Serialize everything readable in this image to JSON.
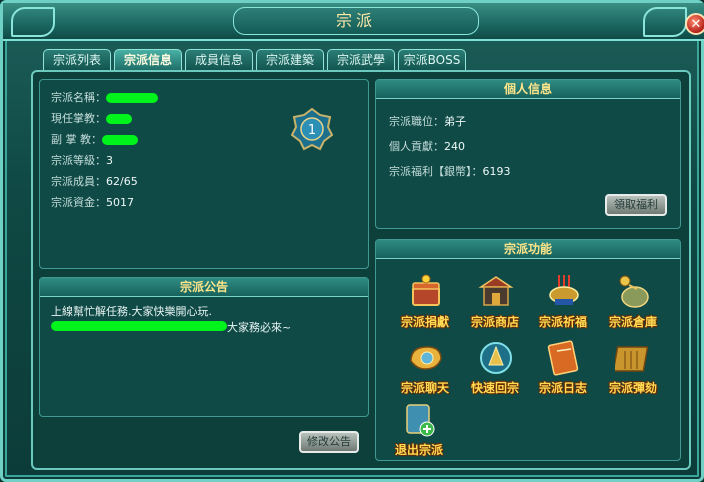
{
  "window": {
    "title": "宗派",
    "close_label": "✕"
  },
  "tabs": [
    {
      "label": "宗派列表",
      "active": false
    },
    {
      "label": "宗派信息",
      "active": true
    },
    {
      "label": "成員信息",
      "active": false
    },
    {
      "label": "宗派建築",
      "active": false
    },
    {
      "label": "宗派武學",
      "active": false
    },
    {
      "label": "宗派BOSS",
      "active": false
    }
  ],
  "sect_info": {
    "name_label": "宗派名稱：",
    "leader_label": "現任掌教：",
    "vice_label": "副 掌 教：",
    "level_label": "宗派等級：",
    "level_value": "3",
    "members_label": "宗派成員：",
    "members_value": "62/65",
    "funds_label": "宗派資金：",
    "funds_value": "5017",
    "emblem_level": "1"
  },
  "notice": {
    "title": "宗派公告",
    "line1": "上線幫忙解任務.大家快樂開心玩.",
    "line2_suffix": "大家務必來~",
    "edit_button": "修改公告"
  },
  "personal": {
    "title": "個人信息",
    "position_label": "宗派職位：",
    "position_value": "弟子",
    "contribution_label": "個人貢獻：",
    "contribution_value": "240",
    "welfare_label": "宗派福利【銀幣】：",
    "welfare_value": "6193",
    "claim_button": "領取福利"
  },
  "functions": {
    "title": "宗派功能",
    "items": [
      {
        "label": "宗派捐獻",
        "icon": "donation-chest-icon"
      },
      {
        "label": "宗派商店",
        "icon": "shop-building-icon"
      },
      {
        "label": "宗派祈福",
        "icon": "incense-burner-icon"
      },
      {
        "label": "宗派倉庫",
        "icon": "warehouse-sack-icon"
      },
      {
        "label": "宗派聊天",
        "icon": "chat-horn-icon"
      },
      {
        "label": "快速回宗",
        "icon": "return-portal-icon"
      },
      {
        "label": "宗派日志",
        "icon": "log-book-icon"
      },
      {
        "label": "宗派彈劾",
        "icon": "impeach-scroll-icon"
      },
      {
        "label": "退出宗派",
        "icon": "exit-scroll-icon"
      }
    ]
  },
  "colors": {
    "accent": "#ffdc54",
    "panel": "#0f4a47",
    "border": "#6cc9be",
    "redaction": "#00f31a"
  }
}
